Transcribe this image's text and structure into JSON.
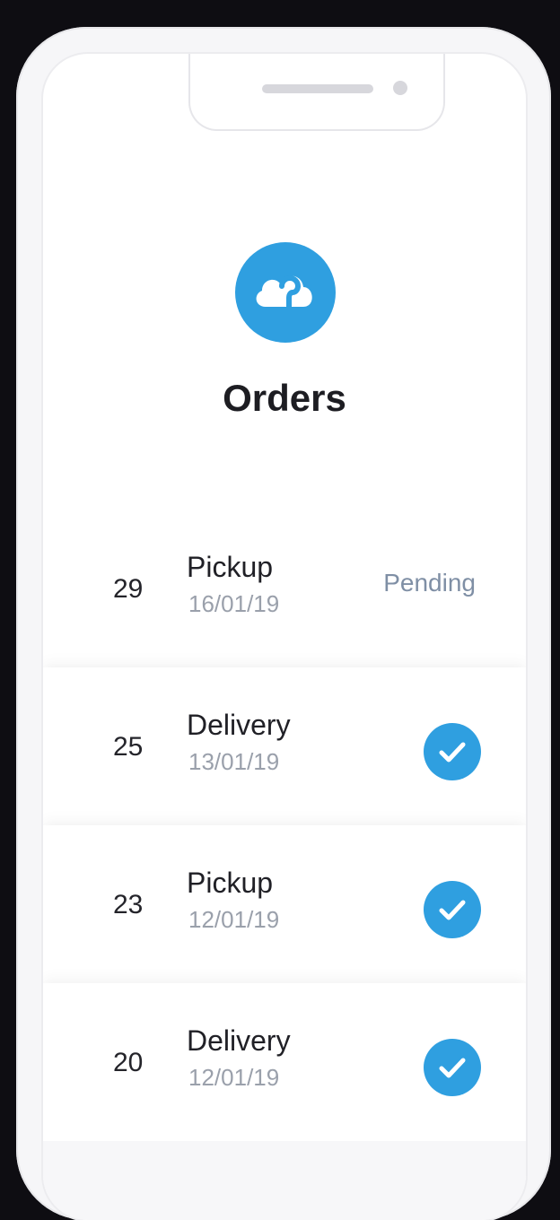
{
  "header": {
    "title": "Orders",
    "logo_icon": "cloud-icon",
    "accent_color": "#2f9fe0"
  },
  "orders": [
    {
      "number": "29",
      "type": "Pickup",
      "date": "16/01/19",
      "status": "Pending"
    },
    {
      "number": "25",
      "type": "Delivery",
      "date": "13/01/19",
      "status_icon": "check-circle-icon"
    },
    {
      "number": "23",
      "type": "Pickup",
      "date": "12/01/19",
      "status_icon": "check-circle-icon"
    },
    {
      "number": "20",
      "type": "Delivery",
      "date": "12/01/19",
      "status_icon": "check-circle-icon"
    }
  ]
}
